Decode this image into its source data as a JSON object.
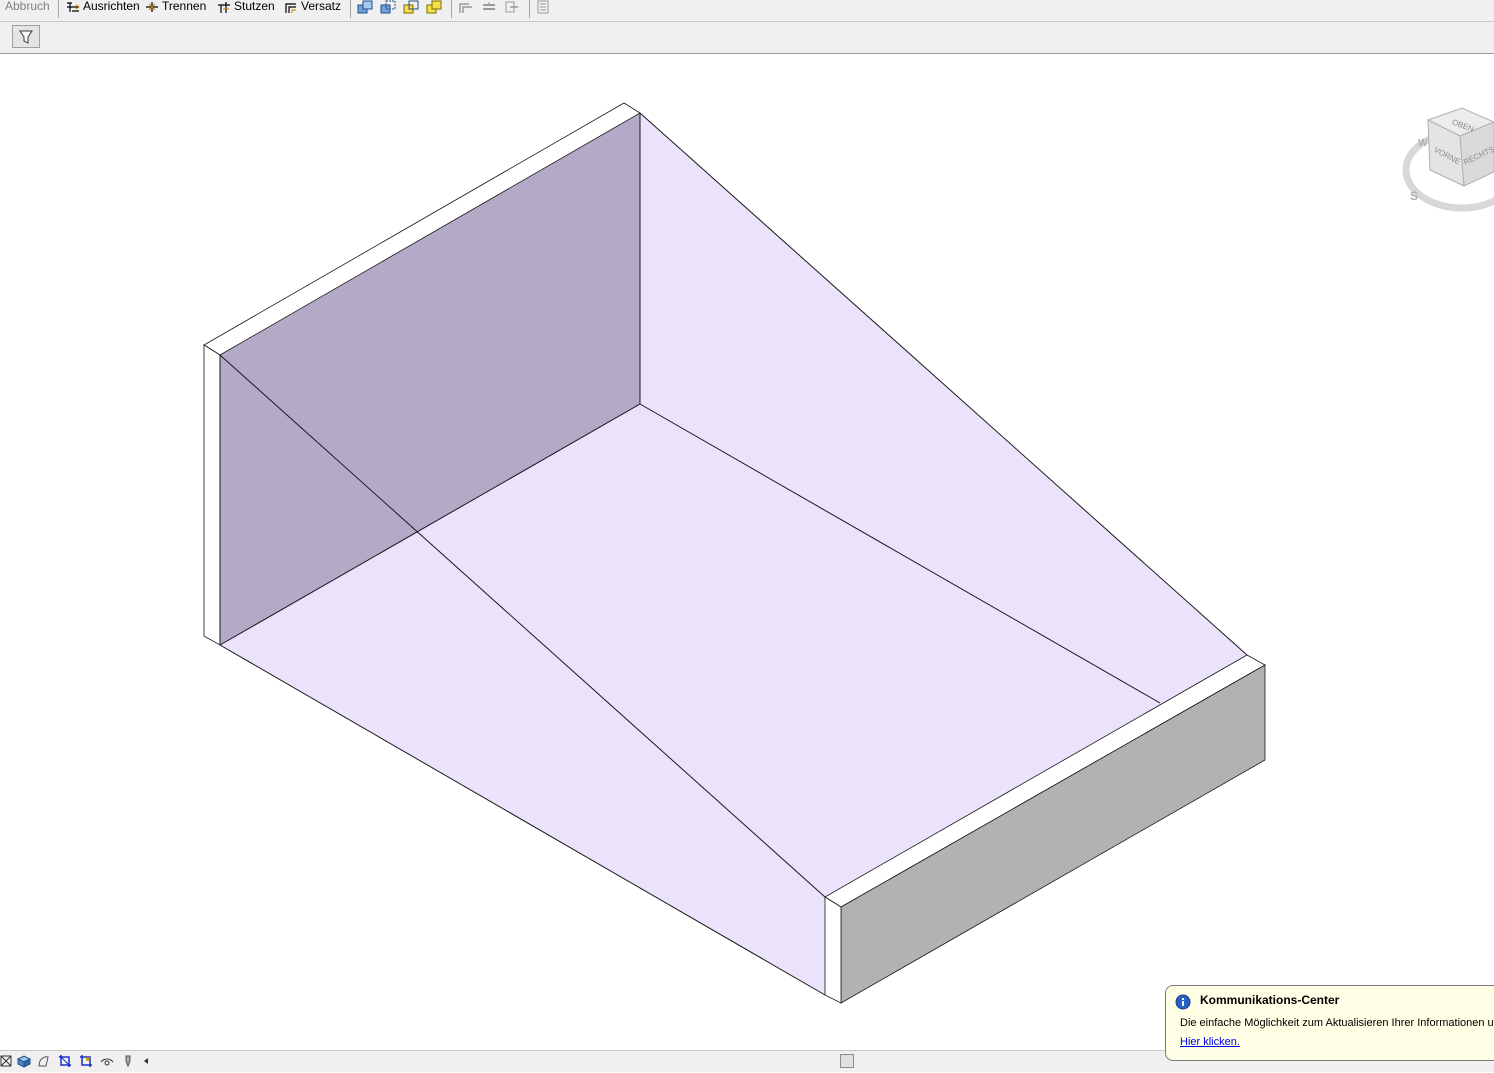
{
  "toolbar": {
    "abbruch_label": "Abbruch",
    "ausrichten_label": "Ausrichten",
    "trennen_label": "Trennen",
    "stutzen_label": "Stutzen",
    "versatz_label": "Versatz"
  },
  "viewcube": {
    "top": "OBEN",
    "front": "VORNE",
    "right": "RECHTS",
    "west": "W",
    "south": "S"
  },
  "notification": {
    "title": "Kommunikations-Center",
    "message": "Die einfache Möglichkeit zum Aktualisieren Ihrer Informationen und",
    "link": "Hier klicken."
  },
  "colors": {
    "floor": "#ebe3fb",
    "back_wall": "#b4aac7",
    "wall_side": "#b2b2b2",
    "toolbar_bg": "#f0f0f0",
    "notification_bg": "#ffffe6"
  }
}
